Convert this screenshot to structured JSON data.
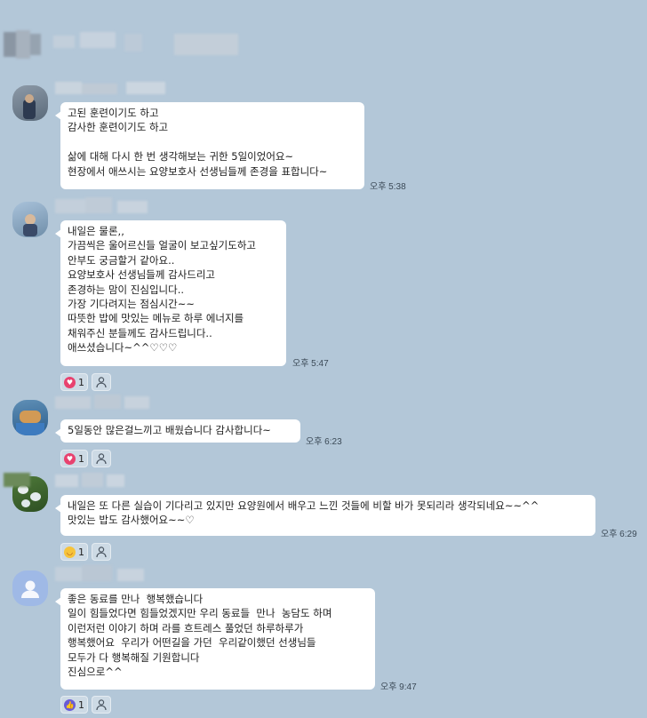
{
  "chat": {
    "messages": [
      {
        "id": "m1",
        "lines": "고된 훈련이기도 하고\n감사한 훈련이기도 하고\n\n삶에 대해 다시 한 번 생각해보는 귀한 5일이었어요~\n현장에서 애쓰시는 요양보호사 선생님들께 존경을 표합니다~",
        "time": "오후 5:38"
      },
      {
        "id": "m2",
        "lines": "내일은 물론,,\n가끔씩은 울어르신들 얼굴이 보고싶기도하고\n안부도 궁금할거 같아요..\n요양보호사 선생님들께 감사드리고\n존경하는 맘이 진심입니다..\n가장 기다려지는 점심시간~~\n따뜻한 밥에 맛있는 메뉴로 하루 에너지를\n채워주신 분들께도 감사드립니다..\n애쓰셨습니다~^^♡♡♡",
        "time": "오후 5:47",
        "reaction": {
          "emoji": "heart",
          "count": "1"
        }
      },
      {
        "id": "m3",
        "lines": "5일동안 많은걸느끼고 배웠습니다 감사합니다~",
        "time": "오후 6:23",
        "reaction": {
          "emoji": "heart",
          "count": "1"
        }
      },
      {
        "id": "m4",
        "lines": "내일은 또 다른 실습이 기다리고 있지만 요양원에서 배우고 느낀 것들에 비할 바가 못되리라 생각되네요~~^^\n맛있는 밥도 감사했어요~~♡",
        "time": "오후 6:29",
        "reaction": {
          "emoji": "laugh",
          "count": "1"
        }
      },
      {
        "id": "m5",
        "lines": "좋은 동료를 만나  행복했습니다\n일이 힘들었다면 힘들었겠지만 우리 동료들  만나  농담도 하며\n이런저런 이야기 하며 라를 흐트레스 풀었던 하루하루가\n행복했어요  우리가 어떤길을 가던  우리같이했던 선생님들\n모두가 다 행복해질 기원합니다\n진심으로^^",
        "time": "오후 9:47",
        "reaction": {
          "emoji": "thumbs-up",
          "count": "1"
        }
      }
    ]
  },
  "colors": {
    "background": "#b3c7d8",
    "bubble": "#ffffff",
    "heart": "#e8426f",
    "laugh": "#f6c33a",
    "thumbs": "#6a5bd6"
  }
}
